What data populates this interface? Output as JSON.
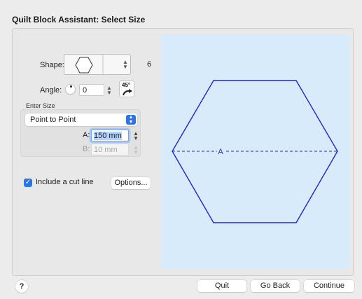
{
  "window": {
    "title": "Quilt Block Assistant: Select Size"
  },
  "shape": {
    "label": "Shape:",
    "sides": "6",
    "icon": "hexagon-icon"
  },
  "angle": {
    "label": "Angle:",
    "value": "0",
    "rotate_label": "45°",
    "rotate_icon": "rotate-45-icon"
  },
  "size": {
    "section_label": "Enter Size",
    "mode": "Point to Point",
    "a_label": "A:",
    "a_value": "150 mm",
    "b_label": "B:",
    "b_value": "10 mm"
  },
  "cut_line": {
    "label": "Include a cut line",
    "checked": true,
    "options_label": "Options..."
  },
  "preview": {
    "dimension_label": "A",
    "stroke_color": "#1e28c8",
    "background": "#d8ebfb"
  },
  "footer": {
    "help_label": "?",
    "quit_label": "Quit",
    "back_label": "Go Back",
    "continue_label": "Continue"
  }
}
